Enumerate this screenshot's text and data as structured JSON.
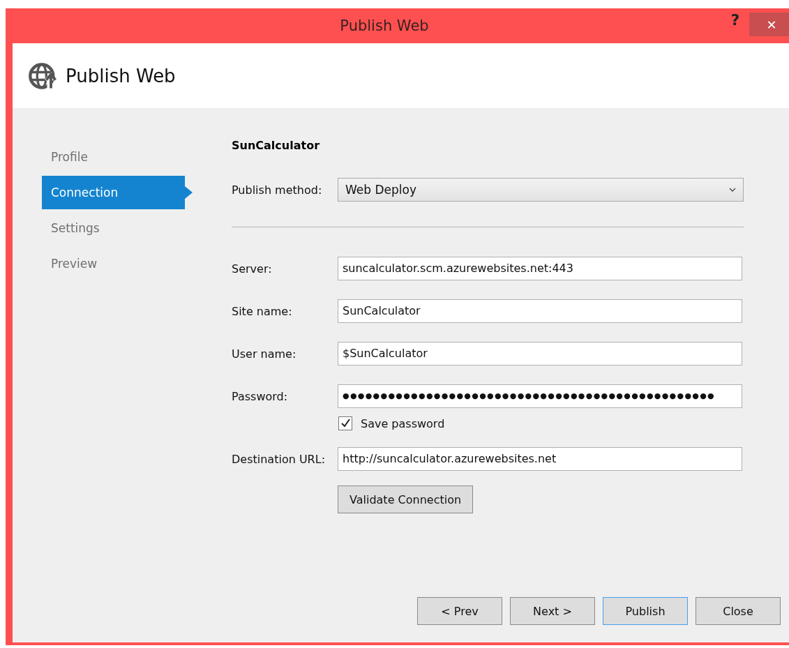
{
  "window": {
    "title": "Publish Web",
    "help": "?",
    "close": "✕"
  },
  "header": {
    "title": "Publish Web"
  },
  "sidebar": {
    "items": [
      {
        "label": "Profile",
        "selected": false
      },
      {
        "label": "Connection",
        "selected": true
      },
      {
        "label": "Settings",
        "selected": false
      },
      {
        "label": "Preview",
        "selected": false
      }
    ]
  },
  "profile_name": "SunCalculator",
  "publish_method": {
    "label": "Publish method:",
    "value": "Web Deploy"
  },
  "fields": [
    {
      "kind": "text",
      "label": "Server:",
      "value": "suncalculator.scm.azurewebsites.net:443"
    },
    {
      "kind": "text",
      "label": "Site name:",
      "value": "SunCalculator"
    },
    {
      "kind": "text",
      "label": "User name:",
      "value": "$SunCalculator"
    },
    {
      "kind": "password",
      "label": "Password:",
      "value": "●●●●●●●●●●●●●●●●●●●●●●●●●●●●●●●●●●●●●●●●●●●●●●●●●"
    },
    {
      "kind": "checkbox",
      "label": "Save password",
      "checked": true
    },
    {
      "kind": "text",
      "label": "Destination URL:",
      "value": "http://suncalculator.azurewebsites.net"
    },
    {
      "kind": "button",
      "label": "Validate Connection"
    }
  ],
  "buttons": [
    {
      "label": "< Prev",
      "focused": false
    },
    {
      "label": "Next >",
      "focused": false
    },
    {
      "label": "Publish",
      "focused": true
    },
    {
      "label": "Close",
      "focused": false
    }
  ]
}
